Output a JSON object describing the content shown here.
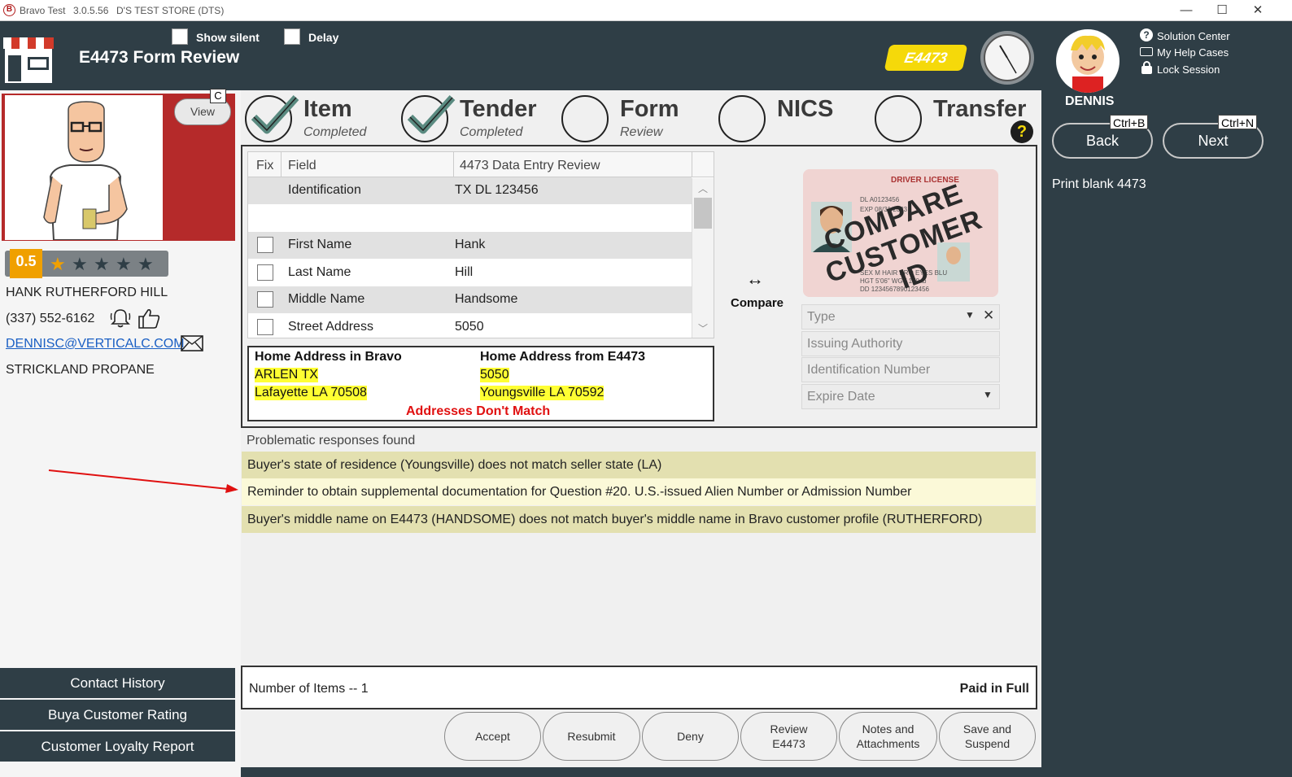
{
  "window": {
    "app": "Bravo Test",
    "version": "3.0.5.56",
    "store": "D'S TEST STORE (DTS)"
  },
  "header": {
    "show_silent": "Show silent",
    "delay": "Delay",
    "title": "E4473 Form Review",
    "badge": "E4473"
  },
  "top_links": [
    "Solution Center",
    "My Help Cases",
    "Lock Session"
  ],
  "user": {
    "name": "DENNIS"
  },
  "nav": {
    "back": "Back",
    "back_shortcut": "Ctrl+B",
    "next": "Next",
    "next_shortcut": "Ctrl+N",
    "print_blank": "Print blank 4473"
  },
  "customer": {
    "view_label": "View",
    "c_label": "C",
    "rating": "0.5",
    "name": "HANK RUTHERFORD HILL",
    "phone": "(337) 552-6162",
    "email": "DENNISC@VERTICALC.COM",
    "company": "STRICKLAND PROPANE"
  },
  "sidebar_links": [
    "Contact History",
    "Buya Customer Rating",
    "Customer Loyalty Report"
  ],
  "steps": [
    {
      "title": "Item",
      "sub": "Completed",
      "done": true
    },
    {
      "title": "Tender",
      "sub": "Completed",
      "done": true
    },
    {
      "title": "Form",
      "sub": "Review",
      "done": false
    },
    {
      "title": "NICS",
      "sub": "",
      "done": false
    },
    {
      "title": "Transfer",
      "sub": "",
      "done": false
    }
  ],
  "grid": {
    "headers": [
      "Fix",
      "Field",
      "4473 Data Entry Review"
    ],
    "id_row": {
      "field": "Identification",
      "value": "TX DL 123456"
    },
    "rows": [
      {
        "field": "First Name",
        "value": "Hank"
      },
      {
        "field": "Last Name",
        "value": "Hill"
      },
      {
        "field": "Middle Name",
        "value": "Handsome"
      },
      {
        "field": "Street Address",
        "value": "5050"
      }
    ]
  },
  "address_compare": {
    "bravo_title": "Home Address in Bravo",
    "bravo_line1": "ARLEN TX",
    "bravo_line2": "Lafayette LA 70508",
    "form_title": "Home Address from E4473",
    "form_line1": "5050",
    "form_line2": "Youngsville LA 70592",
    "mismatch": "Addresses Don't Match"
  },
  "compare": {
    "arrow": "↔",
    "label": "Compare",
    "card_header": "DRIVER LICENSE",
    "card_stamp_1": "COMPARE",
    "card_stamp_2": "CUSTOMER ID",
    "fields": [
      "Type",
      "Issuing Authority",
      "Identification Number",
      "Expire Date"
    ]
  },
  "problems": {
    "title": "Problematic responses found",
    "items": [
      "Buyer's state of residence (Youngsville) does not match seller state (LA)",
      "Reminder to obtain supplemental documentation for Question #20. U.S.-issued Alien Number or Admission Number",
      "Buyer's middle name on E4473 (HANDSOME) does not match buyer's middle name in Bravo customer profile (RUTHERFORD)"
    ]
  },
  "summary": {
    "items": "Number of Items -- 1",
    "paid": "Paid in Full"
  },
  "actions": {
    "accept": "Accept",
    "resubmit": "Resubmit",
    "deny": "Deny",
    "review_1": "Review",
    "review_2": "E4473",
    "notes_1": "Notes and",
    "notes_2": "Attachments",
    "save_1": "Save and",
    "save_2": "Suspend"
  },
  "colors": {
    "accent_yellow": "#f5d90a",
    "highlight": "#ffff33",
    "problem_bg": "#e3e0b0",
    "error_red": "#e01010",
    "header": "#2f3e46"
  }
}
